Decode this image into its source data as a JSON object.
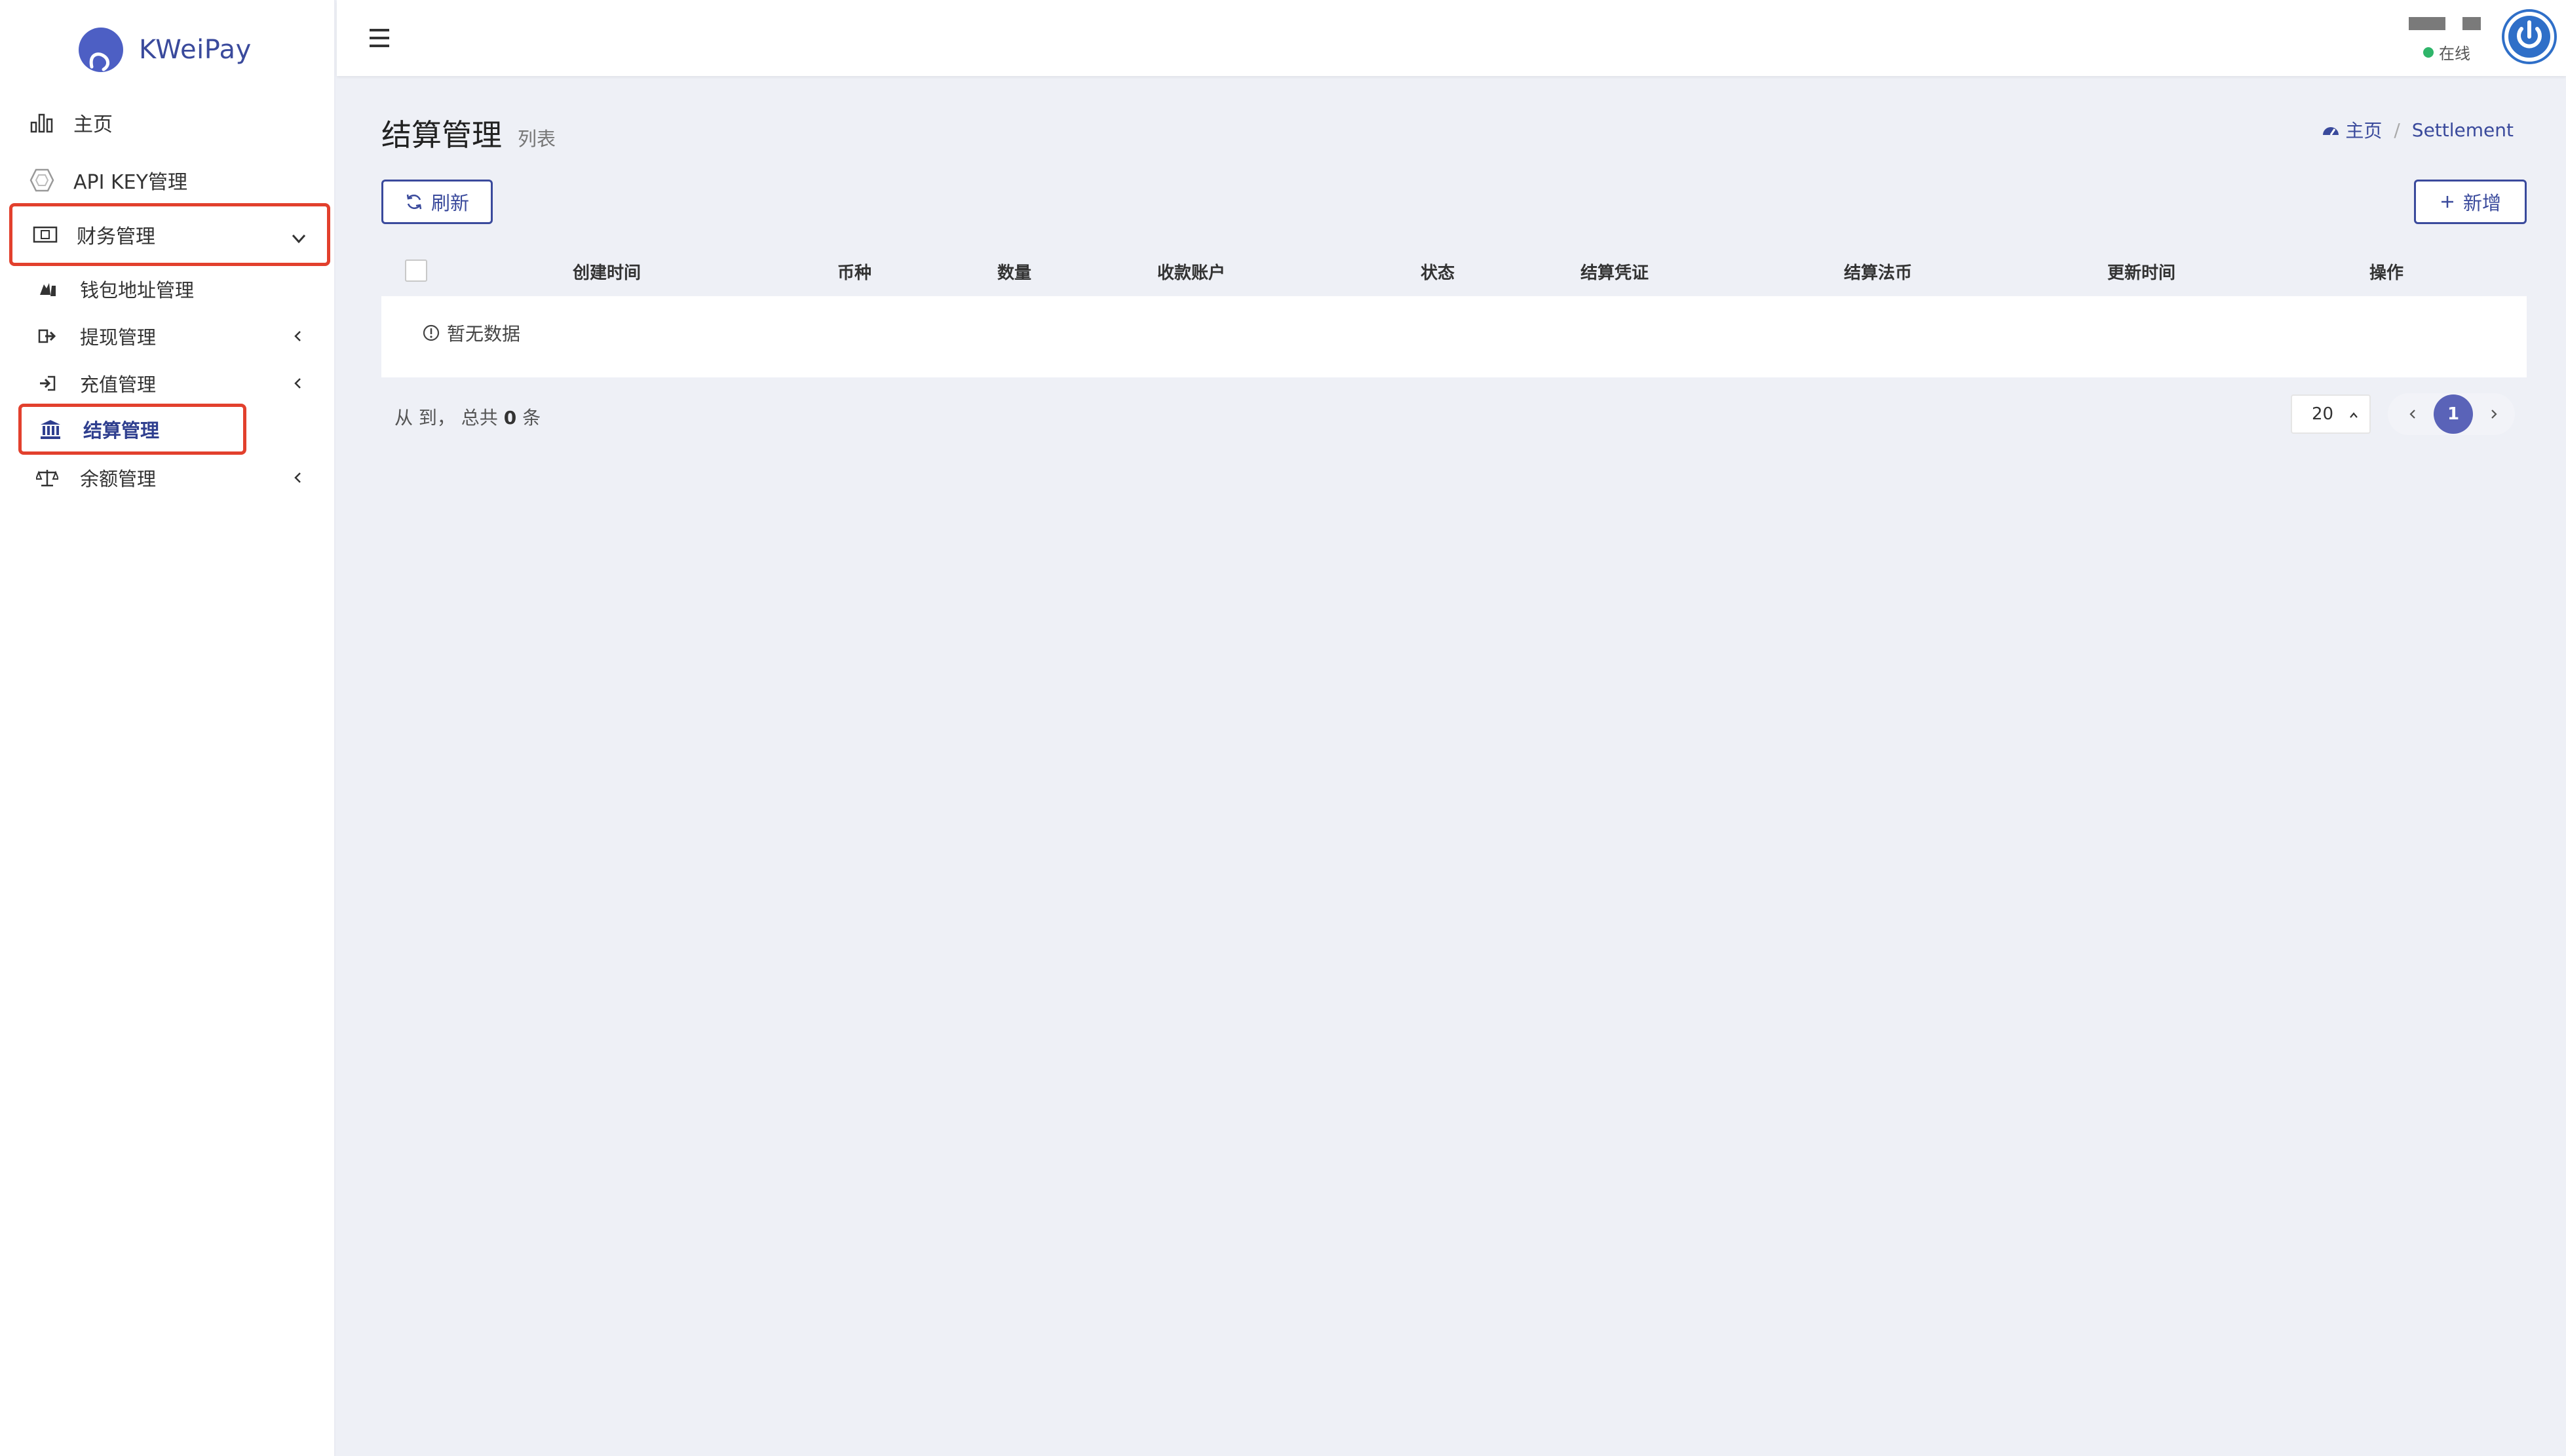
{
  "brand": {
    "name": "KWeiPay"
  },
  "sidebar": {
    "items": [
      {
        "label": "主页",
        "icon": "bar-chart-icon"
      },
      {
        "label": "API KEY管理",
        "icon": "hexagon-icon"
      },
      {
        "label": "财务管理",
        "icon": "money-icon",
        "expanded": true
      }
    ],
    "sub_items": [
      {
        "label": "钱包地址管理",
        "icon": "wallet-icon"
      },
      {
        "label": "提现管理",
        "icon": "sign-out-icon"
      },
      {
        "label": "充值管理",
        "icon": "sign-in-icon"
      },
      {
        "label": "结算管理",
        "icon": "bank-icon",
        "active": true
      },
      {
        "label": "余额管理",
        "icon": "balance-scale-icon"
      }
    ]
  },
  "topbar": {
    "status": "在线",
    "status_color": "#2fb56a"
  },
  "page": {
    "title": "结算管理",
    "subtitle": "列表"
  },
  "breadcrumb": {
    "home": "主页",
    "separator": "/",
    "current": "Settlement"
  },
  "toolbar": {
    "refresh_label": "刷新",
    "add_label": "新增"
  },
  "table": {
    "columns": [
      "创建时间",
      "币种",
      "数量",
      "收款账户",
      "状态",
      "结算凭证",
      "结算法币",
      "更新时间",
      "操作"
    ],
    "empty_text": "暂无数据"
  },
  "pagination": {
    "summary_prefix": "从 到， 总共",
    "total": "0",
    "summary_suffix": "条",
    "page_size": "20",
    "current_page": "1"
  },
  "colors": {
    "accent": "#3a4a9c",
    "highlight_border": "#e2402d",
    "pager_active": "#5a63b8",
    "background": "#eef0f6"
  }
}
